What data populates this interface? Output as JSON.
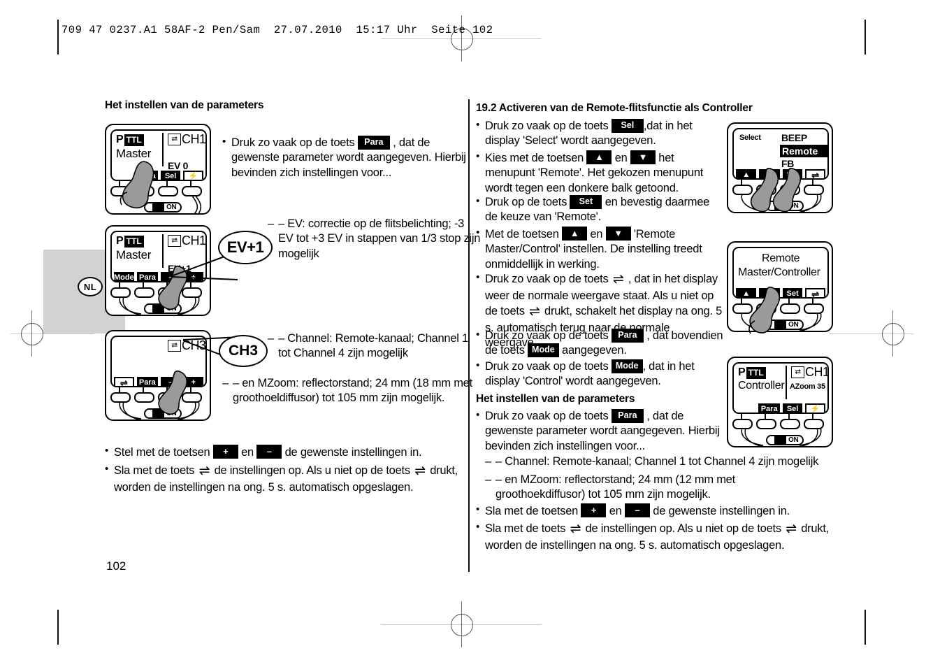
{
  "header": {
    "meta": "709 47 0237.A1 58AF-2 Pen/Sam  27.07.2010  15:17 Uhr  Seite 102"
  },
  "language_badge": "NL",
  "page_number": "102",
  "left_column": {
    "heading": "Het instellen van de parameters",
    "bullets": [
      {
        "parts": [
          {
            "type": "text",
            "value": "Druk zo vaak op de toets "
          },
          {
            "type": "key",
            "value": "Para"
          },
          {
            "type": "text",
            "value": " , dat de gewenste parameter wordt aangegeven. Hierbij bevinden zich instellingen voor..."
          }
        ]
      }
    ],
    "annotation_ev": "– EV: correctie op de flitsbelichting;  -3 EV tot +3 EV in stappen van 1/3 stop zijn mogelijk",
    "annotation_channel": "– Channel: Remote-kanaal;  Channel 1 tot Channel 4 zijn mogelijk",
    "annotation_mzoom": "– en MZoom: reflectorstand; 24 mm (18 mm met groothoeldiffusor) tot 105 mm zijn mogelijk.",
    "final_bullets": [
      {
        "parts": [
          {
            "type": "text",
            "value": "Stel met de toetsen "
          },
          {
            "type": "key-sym",
            "value": "+"
          },
          {
            "type": "text",
            "value": " en "
          },
          {
            "type": "key-sym",
            "value": "–"
          },
          {
            "type": "text",
            "value": " de gewenste instellingen in."
          }
        ]
      },
      {
        "parts": [
          {
            "type": "text",
            "value": "Sla met de toets "
          },
          {
            "type": "ret",
            "value": "⇌"
          },
          {
            "type": "text",
            "value": " de instellingen op. Als u niet op de toets "
          },
          {
            "type": "ret",
            "value": "⇌"
          },
          {
            "type": "text",
            "value": " drukt, worden de instellingen na ong. 5 s. automatisch opgeslagen."
          }
        ]
      }
    ],
    "callout_ev": "EV+1",
    "callout_ch": "CH3"
  },
  "right_column": {
    "heading": "19.2 Activeren van de Remote-flitsfunctie als Controller",
    "bullets": [
      {
        "parts": [
          {
            "type": "text",
            "value": "Druk zo vaak op de toets "
          },
          {
            "type": "key",
            "value": "Sel"
          },
          {
            "type": "text",
            "value": " ,dat in het display 'Select' wordt aangegeven."
          }
        ]
      },
      {
        "parts": [
          {
            "type": "text",
            "value": "Kies met de toetsen "
          },
          {
            "type": "key-sym",
            "value": "▲"
          },
          {
            "type": "text",
            "value": " en "
          },
          {
            "type": "key-sym",
            "value": "▼"
          },
          {
            "type": "text",
            "value": " het menupunt 'Remote'. Het gekozen menupunt wordt tegen een donkere balk getoond."
          }
        ]
      },
      {
        "parts": [
          {
            "type": "text",
            "value": "Druk op de toets "
          },
          {
            "type": "key",
            "value": "Set"
          },
          {
            "type": "text",
            "value": " en bevestig daarmee de keuze van 'Remote'."
          }
        ]
      },
      {
        "parts": [
          {
            "type": "text",
            "value": "Met de toetsen "
          },
          {
            "type": "key-sym",
            "value": "▲"
          },
          {
            "type": "text",
            "value": " en "
          },
          {
            "type": "key-sym",
            "value": "▼"
          },
          {
            "type": "text",
            "value": " 'Remote Master/Control' instellen. De  instelling treedt onmiddellijk in werking."
          }
        ]
      },
      {
        "parts": [
          {
            "type": "text",
            "value": "Druk zo vaak op de toets "
          },
          {
            "type": "ret",
            "value": "⇌"
          },
          {
            "type": "text",
            "value": " , dat in het display weer de normale weergave staat. Als u niet op de toets "
          },
          {
            "type": "ret",
            "value": "⇌"
          },
          {
            "type": "text",
            "value": " drukt, schakelt het display na ong. 5 s. automatisch terug naar de normale weergave."
          }
        ]
      },
      {
        "parts": [
          {
            "type": "text",
            "value": "Druk zo vaak op de toets "
          },
          {
            "type": "key",
            "value": "Para"
          },
          {
            "type": "text",
            "value": " , dat bovendien de toets "
          },
          {
            "type": "key",
            "value": "Mode"
          },
          {
            "type": "text",
            "value": "         aangegeven."
          }
        ]
      },
      {
        "parts": [
          {
            "type": "text",
            "value": "Druk zo vaak op de toets "
          },
          {
            "type": "key",
            "value": "Mode"
          },
          {
            "type": "text",
            "value": ", dat in het display 'Control' wordt aangegeven."
          }
        ]
      }
    ],
    "sub_heading": "Het instellen van de parameters",
    "param_bullet": {
      "parts": [
        {
          "type": "text",
          "value": "Druk zo vaak op de toets "
        },
        {
          "type": "key",
          "value": "Para"
        },
        {
          "type": "text",
          "value": " , dat de gewenste parameter wordt aangegeven. Hierbij bevinden zich instellingen voor..."
        }
      ]
    },
    "dashes": [
      "– Channel: Remote-kanaal;  Channel 1 tot Channel 4 zijn mogelijk",
      "– en MZoom: reflectorstand; 24 mm (12 mm met groothoekdiffusor) tot 105 mm zijn mogelijk."
    ],
    "final_bullets": [
      {
        "parts": [
          {
            "type": "text",
            "value": "Sla met de toetsen "
          },
          {
            "type": "key-sym",
            "value": "+"
          },
          {
            "type": "text",
            "value": " en "
          },
          {
            "type": "key-sym",
            "value": "–"
          },
          {
            "type": "text",
            "value": " de gewenste instellingen in."
          }
        ]
      },
      {
        "parts": [
          {
            "type": "text",
            "value": "Sla met de toets "
          },
          {
            "type": "ret",
            "value": "⇌"
          },
          {
            "type": "text",
            "value": " de instellingen op. Als u niet op de toets "
          },
          {
            "type": "ret",
            "value": "⇌"
          },
          {
            "type": "text",
            "value": " drukt, worden de instellingen na ong. 5 s. automatisch opgeslagen."
          }
        ]
      }
    ]
  },
  "devices": {
    "left1": {
      "mode_tag_p": "P",
      "mode_tag_ttl": "TTL",
      "mode_label": "Master",
      "channel": "CH1",
      "value": "EV 0",
      "buttons": [
        "",
        "Para",
        "Sel",
        "⚡"
      ]
    },
    "left2": {
      "mode_tag_p": "P",
      "mode_tag_ttl": "TTL",
      "mode_label": "Master",
      "channel": "CH1",
      "value": "EV+1",
      "buttons": [
        "Mode",
        "Para",
        "–",
        "+"
      ]
    },
    "left3": {
      "channel": "CH3",
      "buttons": [
        "⇌",
        "Para",
        "–",
        "+"
      ]
    },
    "right1": {
      "menu_label": "Select",
      "items": [
        "BEEP",
        "Remote",
        "FB"
      ],
      "selected": "Remote",
      "buttons": [
        "▲",
        "▼",
        "Set",
        "⇌"
      ]
    },
    "right2": {
      "line1": "Remote",
      "line2": "Master/Controller",
      "buttons": [
        "▲",
        "▼",
        "Set",
        "⇌"
      ]
    },
    "right3": {
      "mode_tag_p": "P",
      "mode_tag_ttl": "TTL",
      "mode_label": "Controller",
      "channel": "CH1",
      "value": "AZoom  35",
      "buttons": [
        "",
        "Para",
        "Sel",
        "⚡"
      ]
    },
    "power_label": "ON"
  }
}
